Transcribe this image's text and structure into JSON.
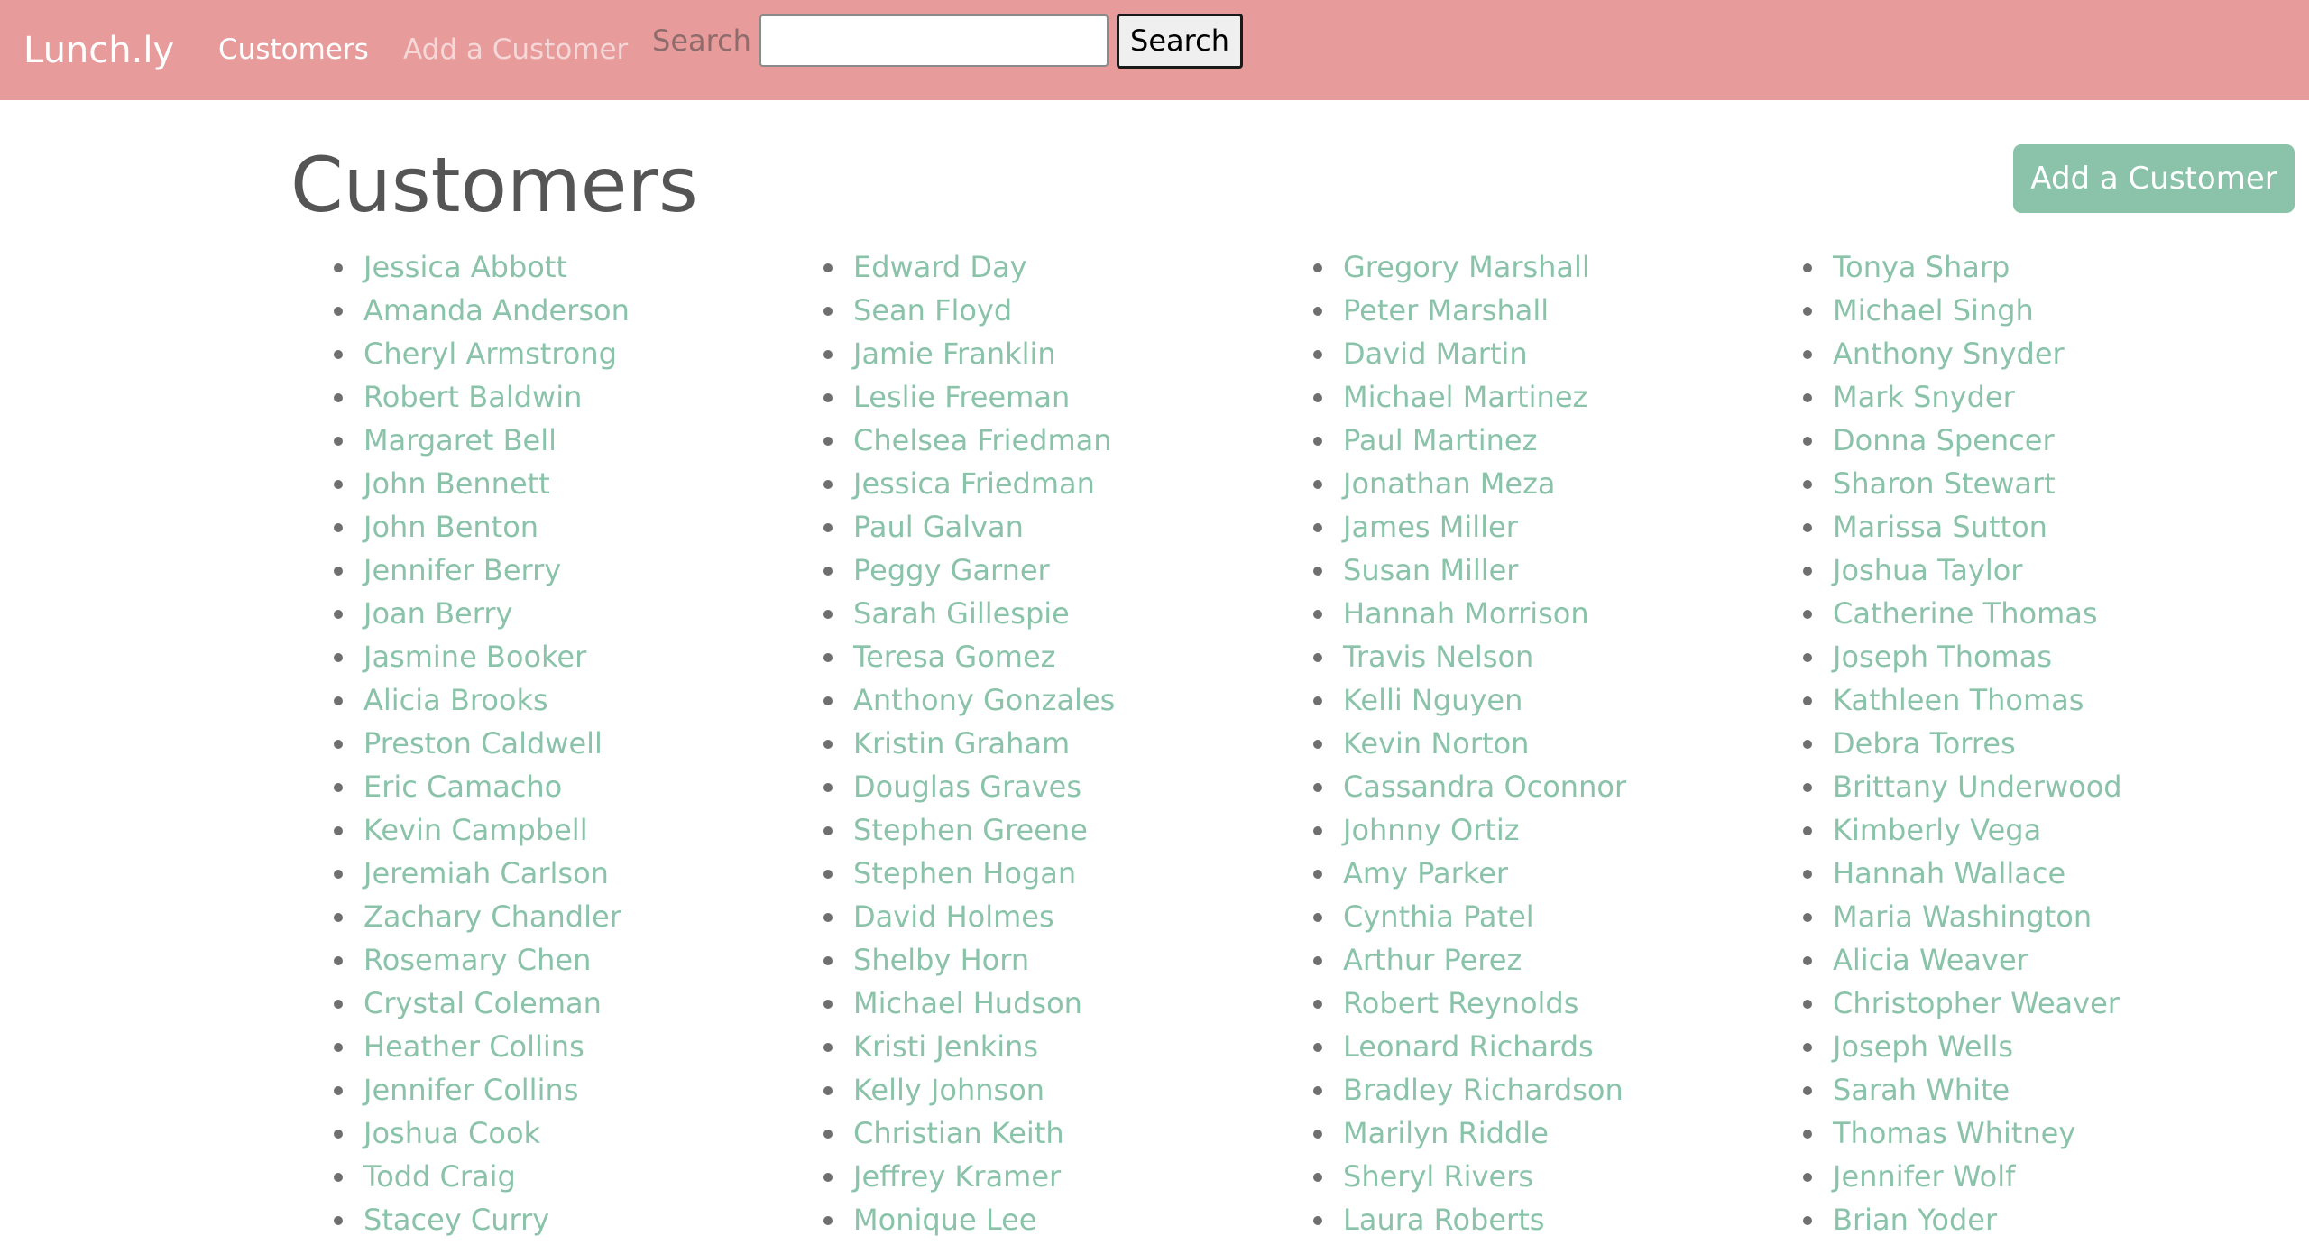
{
  "navbar": {
    "brand": "Lunch.ly",
    "links": [
      "Customers",
      "Add a Customer"
    ],
    "search_label": "Search",
    "search_value": "",
    "search_button": "Search"
  },
  "main": {
    "title": "Customers",
    "add_button": "Add a Customer",
    "columns": [
      [
        "Jessica Abbott",
        "Amanda Anderson",
        "Cheryl Armstrong",
        "Robert Baldwin",
        "Margaret Bell",
        "John Bennett",
        "John Benton",
        "Jennifer Berry",
        "Joan Berry",
        "Jasmine Booker",
        "Alicia Brooks",
        "Preston Caldwell",
        "Eric Camacho",
        "Kevin Campbell",
        "Jeremiah Carlson",
        "Zachary Chandler",
        "Rosemary Chen",
        "Crystal Coleman",
        "Heather Collins",
        "Jennifer Collins",
        "Joshua Cook",
        "Todd Craig",
        "Stacey Curry"
      ],
      [
        "Edward Day",
        "Sean Floyd",
        "Jamie Franklin",
        "Leslie Freeman",
        "Chelsea Friedman",
        "Jessica Friedman",
        "Paul Galvan",
        "Peggy Garner",
        "Sarah Gillespie",
        "Teresa Gomez",
        "Anthony Gonzales",
        "Kristin Graham",
        "Douglas Graves",
        "Stephen Greene",
        "Stephen Hogan",
        "David Holmes",
        "Shelby Horn",
        "Michael Hudson",
        "Kristi Jenkins",
        "Kelly Johnson",
        "Christian Keith",
        "Jeffrey Kramer",
        "Monique Lee"
      ],
      [
        "Gregory Marshall",
        "Peter Marshall",
        "David Martin",
        "Michael Martinez",
        "Paul Martinez",
        "Jonathan Meza",
        "James Miller",
        "Susan Miller",
        "Hannah Morrison",
        "Travis Nelson",
        "Kelli Nguyen",
        "Kevin Norton",
        "Cassandra Oconnor",
        "Johnny Ortiz",
        "Amy Parker",
        "Cynthia Patel",
        "Arthur Perez",
        "Robert Reynolds",
        "Leonard Richards",
        "Bradley Richardson",
        "Marilyn Riddle",
        "Sheryl Rivers",
        "Laura Roberts"
      ],
      [
        "Tonya Sharp",
        "Michael Singh",
        "Anthony Snyder",
        "Mark Snyder",
        "Donna Spencer",
        "Sharon Stewart",
        "Marissa Sutton",
        "Joshua Taylor",
        "Catherine Thomas",
        "Joseph Thomas",
        "Kathleen Thomas",
        "Debra Torres",
        "Brittany Underwood",
        "Kimberly Vega",
        "Hannah Wallace",
        "Maria Washington",
        "Alicia Weaver",
        "Christopher Weaver",
        "Joseph Wells",
        "Sarah White",
        "Thomas Whitney",
        "Jennifer Wolf",
        "Brian Yoder"
      ]
    ]
  },
  "colors": {
    "navbar_bg": "#e79b9b",
    "link": "#8ac3a9",
    "button_bg": "#8ac3a9",
    "title": "#555555"
  }
}
